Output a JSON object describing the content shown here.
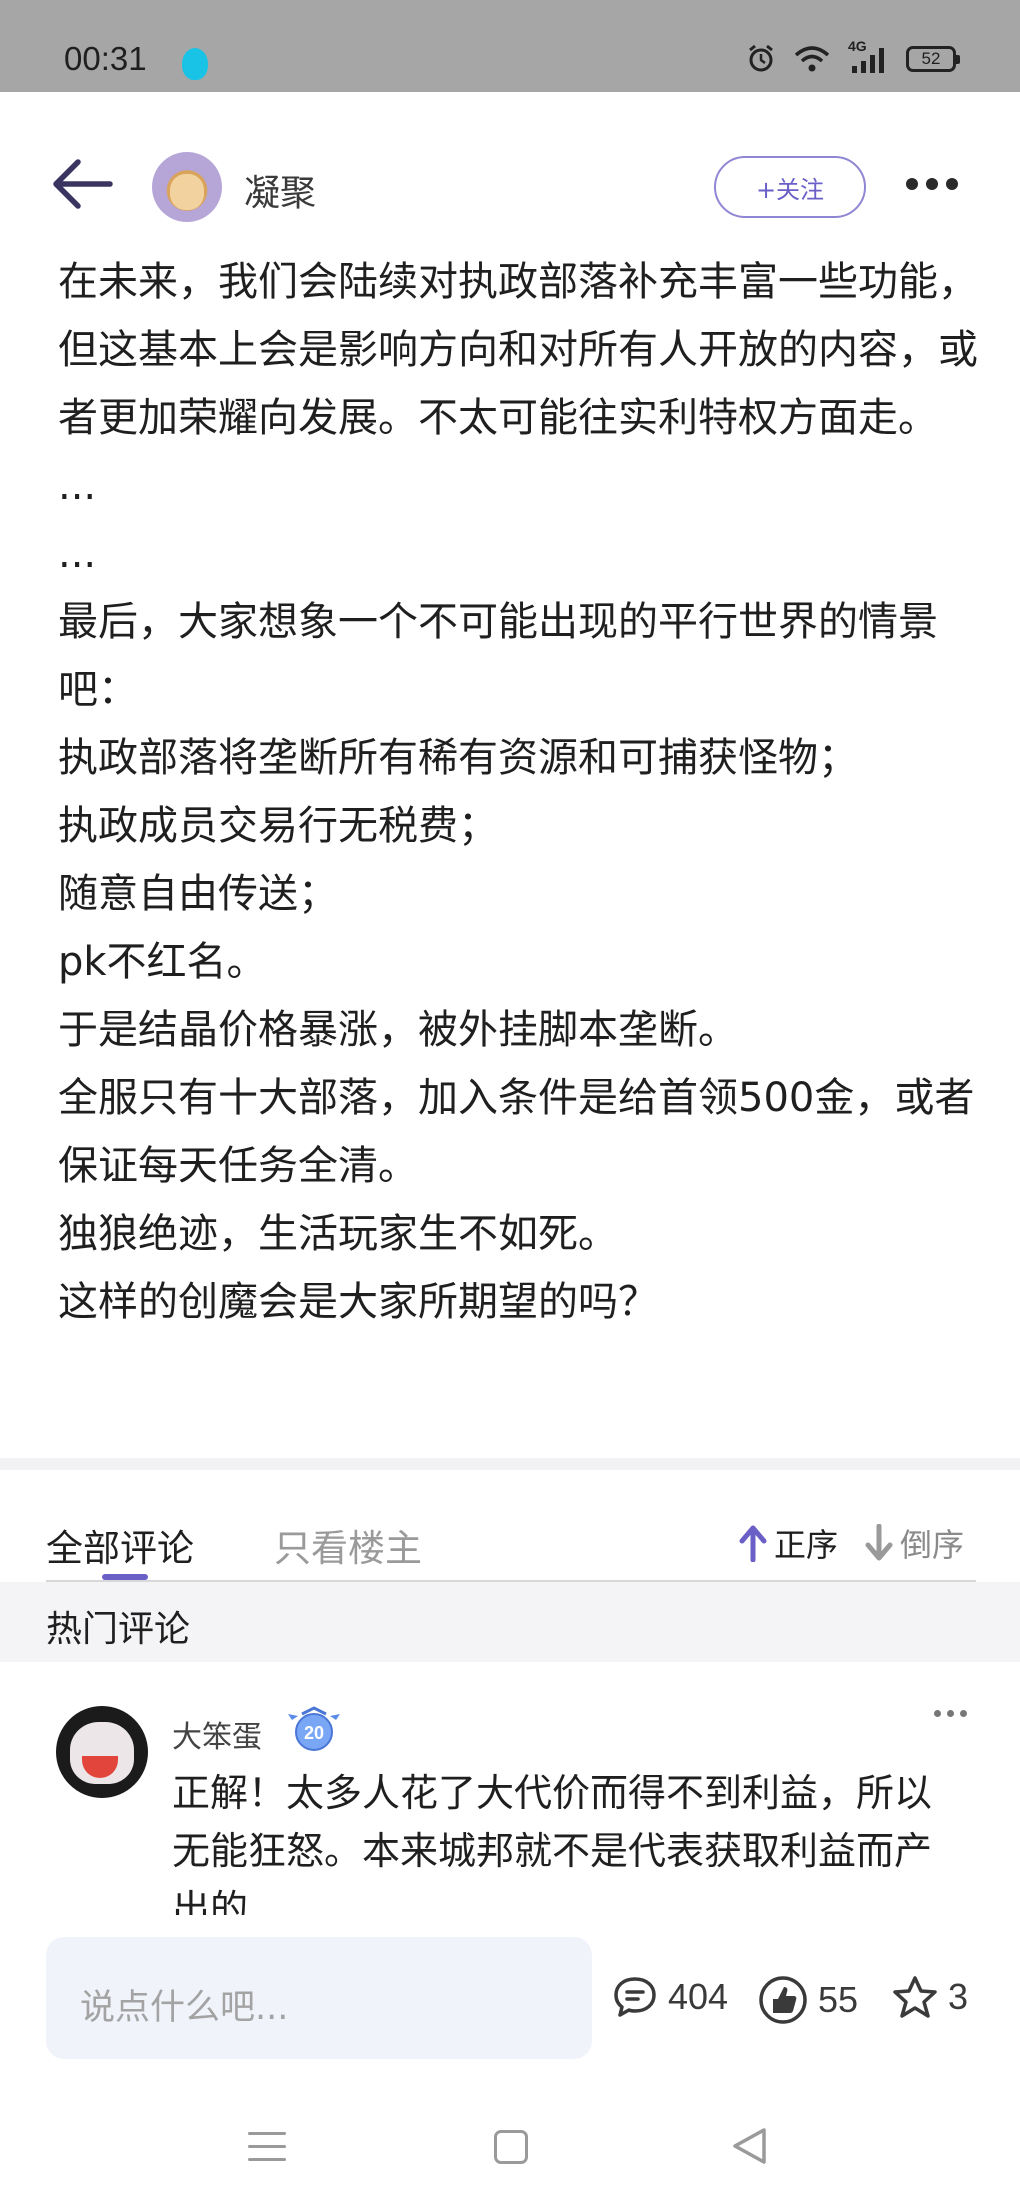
{
  "status_bar": {
    "time": "00:31",
    "network": "4G",
    "battery": "52"
  },
  "header": {
    "author_name": "凝聚",
    "follow_label": "+关注"
  },
  "post": {
    "paragraphs": [
      "在未来，我们会陆续对执政部落补充丰富一些功能，但这基本上会是影响方向和对所有人开放的内容，或者更加荣耀向发展。不太可能往实利特权方面走。",
      "...",
      "...",
      "最后，大家想象一个不可能出现的平行世界的情景吧：",
      "执政部落将垄断所有稀有资源和可捕获怪物；",
      "执政成员交易行无税费；",
      "随意自由传送；",
      "pk不红名。",
      "于是结晶价格暴涨，被外挂脚本垄断。",
      "全服只有十大部落，加入条件是给首领500金，或者保证每天任务全清。",
      "独狼绝迹，生活玩家生不如死。",
      "这样的创魔会是大家所期望的吗？"
    ]
  },
  "comments_section": {
    "tab_all": "全部评论",
    "tab_owner": "只看楼主",
    "sort_asc": "正序",
    "sort_desc": "倒序",
    "hot_title": "热门评论"
  },
  "hot_comment": {
    "author": "大笨蛋",
    "level_badge": "20",
    "text": "正解！太多人花了大代价而得不到利益，所以无能狂怒。本来城邦就不是代表获取利益而产出的"
  },
  "bottom_bar": {
    "input_placeholder": "说点什么吧...",
    "comment_count": "404",
    "like_count": "55",
    "favorite_count": "3"
  },
  "colors": {
    "accent": "#6a5fc6",
    "status_bar_bg": "#a6a6a6",
    "input_bg": "#f1f3fb"
  }
}
